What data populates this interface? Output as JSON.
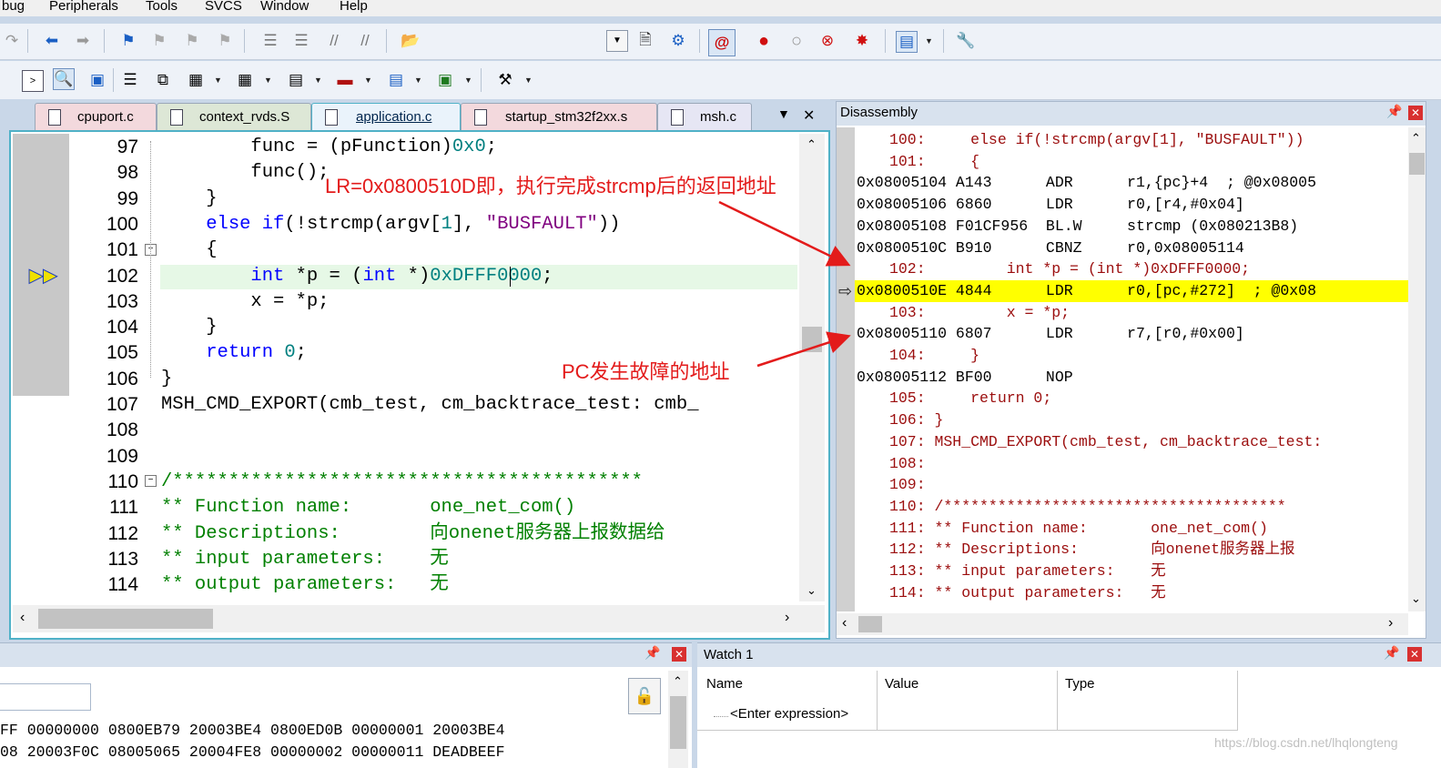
{
  "menu": [
    "bug",
    "Peripherals",
    "Tools",
    "SVCS",
    "Window",
    "Help"
  ],
  "tabs": [
    "cpuport.c",
    "context_rvds.S",
    "application.c",
    "startup_stm32f2xx.s",
    "msh.c"
  ],
  "tab_menu_glyph": "▼",
  "tab_close_glyph": "✕",
  "editor": {
    "lines": [
      {
        "n": "97",
        "indent": "        ",
        "parts": [
          [
            "func = (pFunction)",
            "k"
          ],
          [
            "0x0",
            "t"
          ],
          [
            ";",
            "k"
          ]
        ]
      },
      {
        "n": "98",
        "indent": "        ",
        "parts": [
          [
            "func();",
            "k"
          ]
        ]
      },
      {
        "n": "99",
        "indent": "    ",
        "parts": [
          [
            "}",
            "k"
          ]
        ]
      },
      {
        "n": "100",
        "indent": "    ",
        "parts": [
          [
            "else if",
            "b"
          ],
          [
            "(!strcmp(argv[",
            "k"
          ],
          [
            "1",
            "t"
          ],
          [
            "], ",
            "k"
          ],
          [
            "\"BUSFAULT\"",
            "p"
          ],
          [
            "))",
            "k"
          ]
        ]
      },
      {
        "n": "101",
        "indent": "    ",
        "parts": [
          [
            "{",
            "k"
          ]
        ]
      },
      {
        "n": "102",
        "indent": "        ",
        "parts": [
          [
            "int",
            "b"
          ],
          [
            " *p = (",
            "k"
          ],
          [
            "int",
            "b"
          ],
          [
            " *)",
            "k"
          ],
          [
            "0x",
            "t"
          ],
          [
            "DFFF0000",
            "t"
          ],
          [
            ";",
            "k"
          ]
        ]
      },
      {
        "n": "103",
        "indent": "        ",
        "parts": [
          [
            "x = *p;",
            "k"
          ]
        ]
      },
      {
        "n": "104",
        "indent": "    ",
        "parts": [
          [
            "}",
            "k"
          ]
        ]
      },
      {
        "n": "105",
        "indent": "    ",
        "parts": [
          [
            "return",
            "b"
          ],
          [
            " ",
            "k"
          ],
          [
            "0",
            "t"
          ],
          [
            ";",
            "k"
          ]
        ]
      },
      {
        "n": "106",
        "indent": "",
        "parts": [
          [
            "}",
            "k"
          ]
        ]
      },
      {
        "n": "107",
        "indent": "",
        "parts": [
          [
            "MSH_CMD_EXPORT(cmb_test, cm_backtrace_test: cmb_",
            "k"
          ]
        ]
      },
      {
        "n": "108",
        "indent": "",
        "parts": []
      },
      {
        "n": "109",
        "indent": "",
        "parts": []
      },
      {
        "n": "110",
        "indent": "",
        "parts": [
          [
            "/******************************************",
            "g"
          ]
        ]
      },
      {
        "n": "111",
        "indent": "",
        "parts": [
          [
            "** Function name:       one_net_com()",
            "g"
          ]
        ]
      },
      {
        "n": "112",
        "indent": "",
        "parts": [
          [
            "** Descriptions:        向onenet服务器上报数据给",
            "g"
          ]
        ]
      },
      {
        "n": "113",
        "indent": "",
        "parts": [
          [
            "** input parameters:    无",
            "g"
          ]
        ]
      },
      {
        "n": "114",
        "indent": "",
        "parts": [
          [
            "** output parameters:   无",
            "g"
          ]
        ]
      }
    ]
  },
  "annotations": {
    "lr": "LR=0x0800510D即，执行完成strcmp后的返回地址",
    "pc": "PC发生故障的地址"
  },
  "disassembly": {
    "title": "Disassembly",
    "lines": [
      {
        "text": "100:     else if(!strcmp(argv[1], \"BUSFAULT\"))",
        "kind": "src"
      },
      {
        "text": "101:     {",
        "kind": "src"
      },
      {
        "text": "0x08005104 A143      ADR      r1,{pc}+4  ; @0x08005",
        "kind": "asm"
      },
      {
        "text": "0x08005106 6860      LDR      r0,[r4,#0x04]",
        "kind": "asm"
      },
      {
        "text": "0x08005108 F01CF956  BL.W     strcmp (0x080213B8)",
        "kind": "asm"
      },
      {
        "text": "0x0800510C B910      CBNZ     r0,0x08005114",
        "kind": "asm"
      },
      {
        "text": "102:         int *p = (int *)0xDFFF0000;",
        "kind": "src"
      },
      {
        "text": "0x0800510E 4844      LDR      r0,[pc,#272]  ; @0x08",
        "kind": "cur"
      },
      {
        "text": "103:         x = *p;",
        "kind": "src"
      },
      {
        "text": "0x08005110 6807      LDR      r7,[r0,#0x00]",
        "kind": "asm"
      },
      {
        "text": "104:     }",
        "kind": "src"
      },
      {
        "text": "0x08005112 BF00      NOP",
        "kind": "asm"
      },
      {
        "text": "105:     return 0;",
        "kind": "src"
      },
      {
        "text": "106: }",
        "kind": "src"
      },
      {
        "text": "107: MSH_CMD_EXPORT(cmb_test, cm_backtrace_test:",
        "kind": "src"
      },
      {
        "text": "108:",
        "kind": "src"
      },
      {
        "text": "109:",
        "kind": "src"
      },
      {
        "text": "110: /**************************************",
        "kind": "src"
      },
      {
        "text": "111: ** Function name:       one_net_com()",
        "kind": "src"
      },
      {
        "text": "112: ** Descriptions:        向onenet服务器上报",
        "kind": "src"
      },
      {
        "text": "113: ** input parameters:    无",
        "kind": "src"
      },
      {
        "text": "114: ** output parameters:   无",
        "kind": "src"
      }
    ]
  },
  "memory": {
    "rows": [
      "FF 00000000 0800EB79 20003BE4 0800ED0B 00000001 20003BE4",
      "08 20003F0C 08005065 20004FE8 00000002 00000011 DEADBEEF"
    ]
  },
  "watch": {
    "title": "Watch 1",
    "columns": [
      "Name",
      "Value",
      "Type"
    ],
    "placeholder": "<Enter expression>"
  },
  "watermark": "https://blog.csdn.net/lhqlongteng",
  "colors": {
    "highlight_line": "#ffff00",
    "current_line_bg": "#e8f8e8",
    "annotation": "#e31b1b",
    "editor_border": "#4fb1c7"
  }
}
